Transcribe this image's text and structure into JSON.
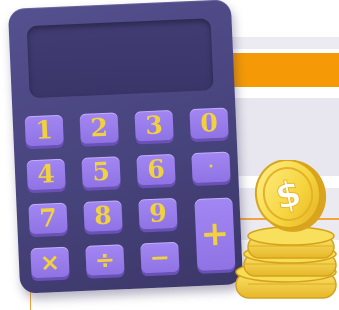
{
  "calculator": {
    "keys": [
      "1",
      "2",
      "3",
      "0",
      "4",
      "5",
      "6",
      ".",
      "7",
      "8",
      "9",
      "×",
      "÷",
      "−"
    ],
    "plus_key": "+"
  },
  "coin": {
    "symbol": "$"
  },
  "colors": {
    "calculator_body": "#4b4782",
    "key_face": "#9a7fee",
    "key_glyph": "#f1d23d",
    "accent_orange": "#f59a06",
    "coin_gold": "#f2d245"
  }
}
